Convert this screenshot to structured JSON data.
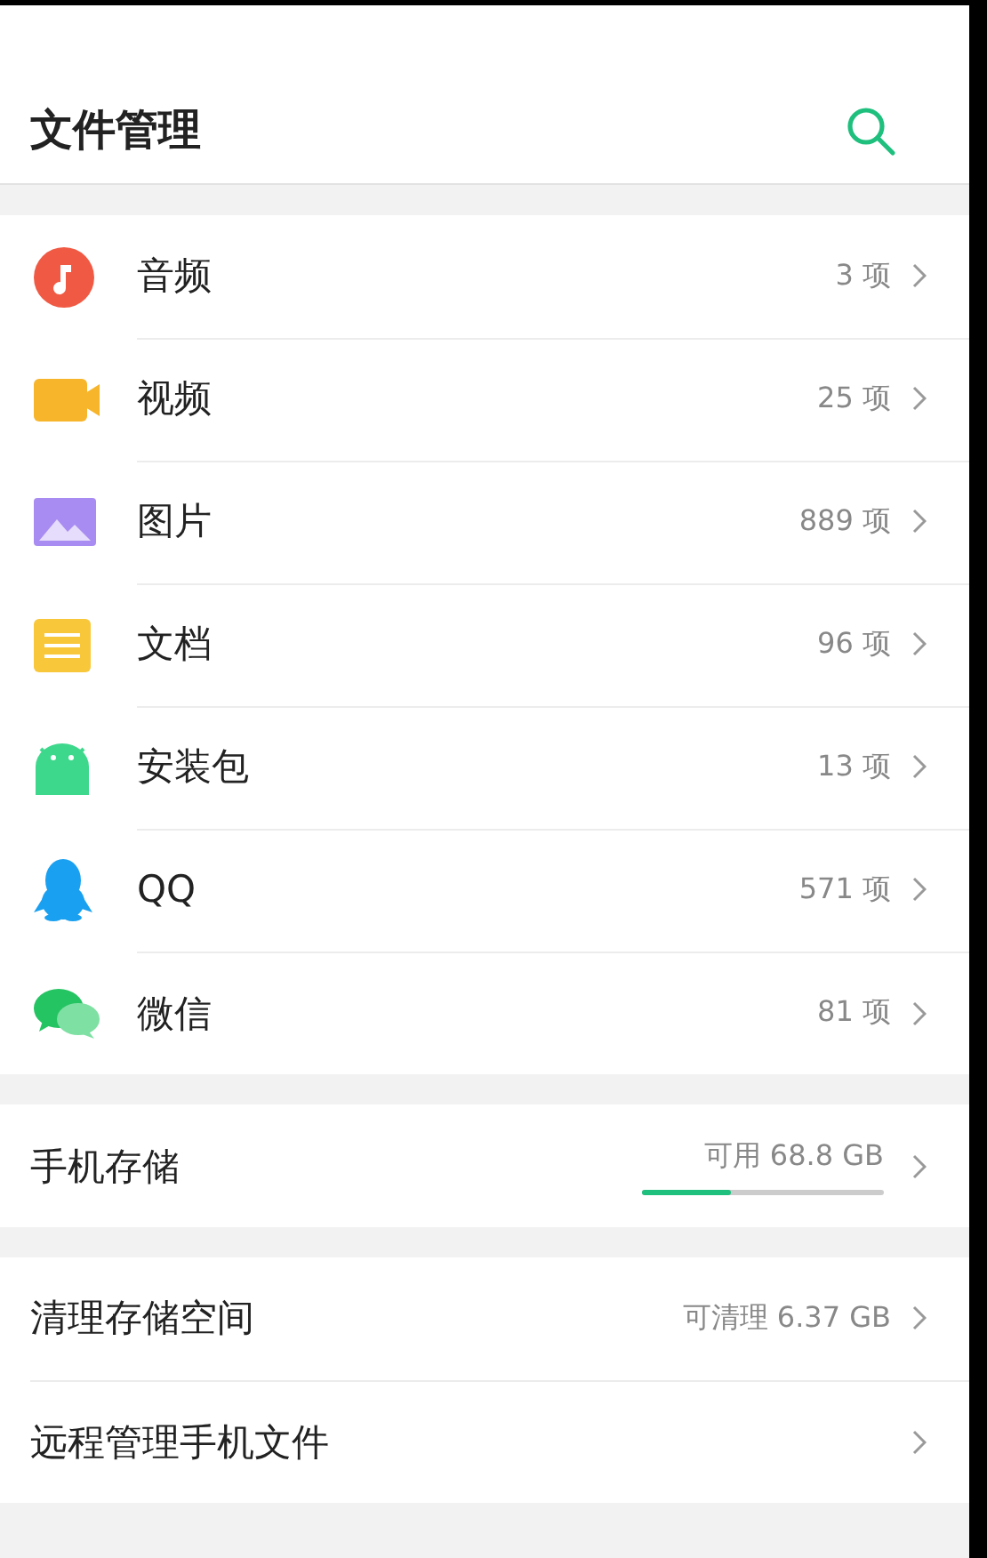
{
  "header": {
    "title": "文件管理"
  },
  "categories": [
    {
      "kind": "music",
      "label": "音频",
      "count": "3 项"
    },
    {
      "kind": "video",
      "label": "视频",
      "count": "25 项"
    },
    {
      "kind": "image",
      "label": "图片",
      "count": "889 项"
    },
    {
      "kind": "document",
      "label": "文档",
      "count": "96 项"
    },
    {
      "kind": "package",
      "label": "安装包",
      "count": "13 项"
    },
    {
      "kind": "penguin",
      "label": "QQ",
      "count": "571 项"
    },
    {
      "kind": "chat",
      "label": "微信",
      "count": "81 项"
    }
  ],
  "storage": {
    "label": "手机存储",
    "available": "可用 68.8 GB",
    "level": 0.37
  },
  "tools": [
    {
      "label": "清理存储空间",
      "value": "可清理 6.37 GB"
    },
    {
      "label": "远程管理手机文件"
    }
  ]
}
